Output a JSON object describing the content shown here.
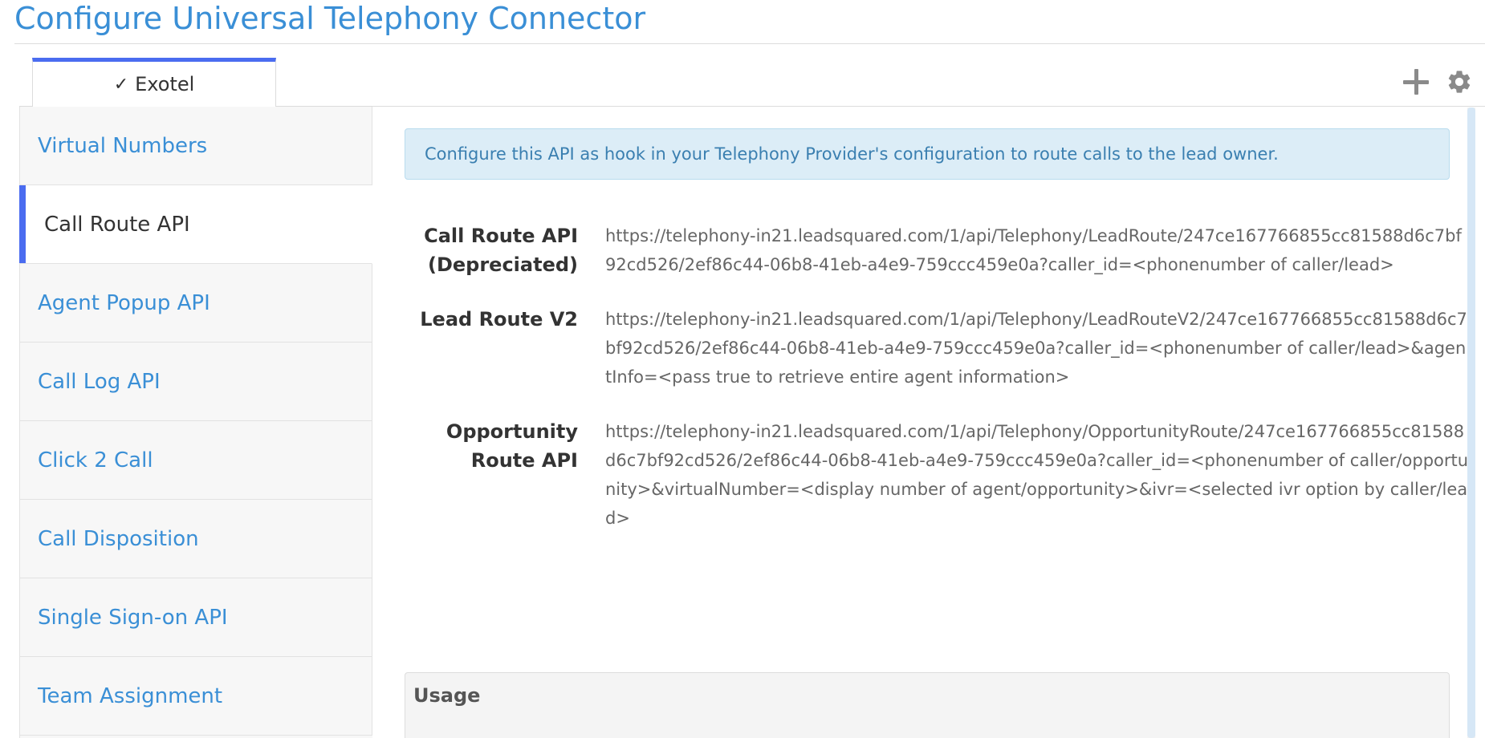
{
  "page": {
    "title": "Configure Universal Telephony Connector"
  },
  "tabs": [
    {
      "check": "✓",
      "label": "Exotel",
      "active": true
    }
  ],
  "toolbar": {
    "add_icon": "plus-icon",
    "settings_icon": "gear-icon"
  },
  "sidebar": {
    "items": [
      {
        "label": "Virtual Numbers",
        "active": false
      },
      {
        "label": "Call Route API",
        "active": true
      },
      {
        "label": "Agent Popup API",
        "active": false
      },
      {
        "label": "Call Log API",
        "active": false
      },
      {
        "label": "Click 2 Call",
        "active": false
      },
      {
        "label": "Call Disposition",
        "active": false
      },
      {
        "label": "Single Sign-on API",
        "active": false
      },
      {
        "label": "Team Assignment",
        "active": false
      }
    ]
  },
  "content": {
    "info": "Configure this API as hook in your Telephony Provider's configuration to route calls to the lead owner.",
    "apis": [
      {
        "label_line1": "Call Route API",
        "label_line2": "(Depreciated)",
        "url": "https://telephony-in21.leadsquared.com/1/api/Telephony/LeadRoute/247ce167766855cc81588d6c7bf92cd526/2ef86c44-06b8-41eb-a4e9-759ccc459e0a?caller_id=<phonenumber of caller/lead>"
      },
      {
        "label_line1": "Lead Route V2",
        "label_line2": "",
        "url": "https://telephony-in21.leadsquared.com/1/api/Telephony/LeadRouteV2/247ce167766855cc81588d6c7bf92cd526/2ef86c44-06b8-41eb-a4e9-759ccc459e0a?caller_id=<phonenumber of caller/lead>&agentInfo=<pass true to retrieve entire agent information>"
      },
      {
        "label_line1": "Opportunity",
        "label_line2": "Route API",
        "url": "https://telephony-in21.leadsquared.com/1/api/Telephony/OpportunityRoute/247ce167766855cc81588d6c7bf92cd526/2ef86c44-06b8-41eb-a4e9-759ccc459e0a?caller_id=<phonenumber of caller/opportunity>&virtualNumber=<display number of agent/opportunity>&ivr=<selected ivr option by caller/lead>"
      }
    ],
    "usage_title": "Usage"
  },
  "colors": {
    "accent": "#4a6cf0",
    "link": "#3a8fd6",
    "info_bg": "#dcedf7"
  }
}
